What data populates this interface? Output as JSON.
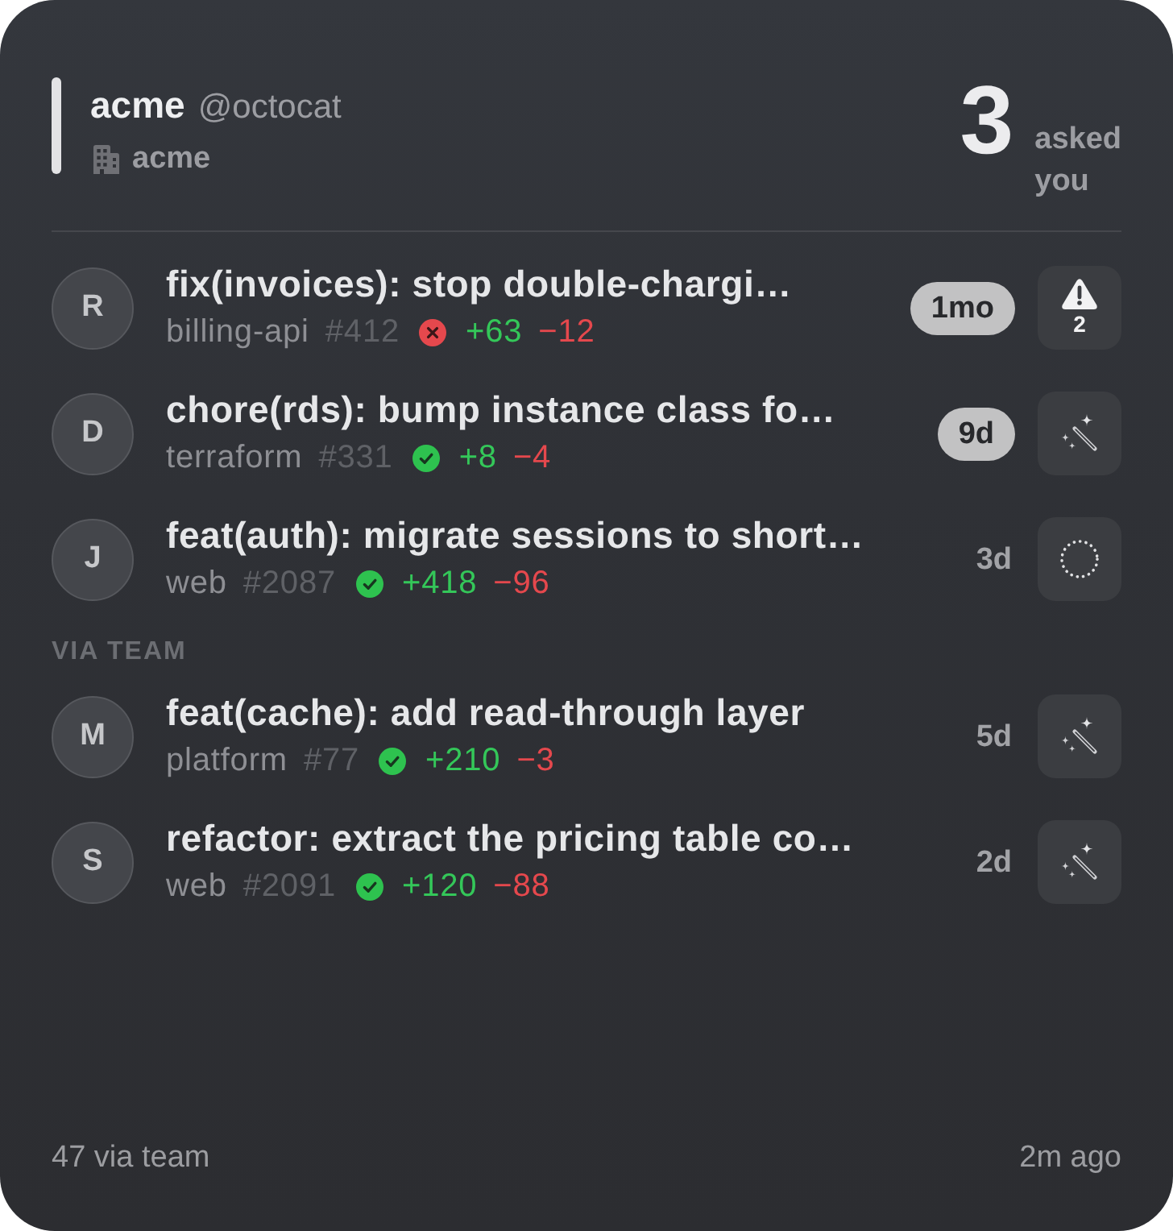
{
  "header": {
    "name": "acme",
    "handle": "@octocat",
    "org": "acme",
    "count": "3",
    "count_label": "asked you"
  },
  "sections": [
    {
      "rows": [
        {
          "initial": "R",
          "title": "fix(invoices): stop double-chargi…",
          "repo": "billing-api",
          "number": "#412",
          "passed": false,
          "additions": "+63",
          "deletions": "−12",
          "age": "1mo",
          "highlighted": true,
          "action": {
            "kind": "alert",
            "count": "2"
          }
        },
        {
          "initial": "D",
          "title": "chore(rds): bump instance class fo…",
          "repo": "terraform",
          "number": "#331",
          "passed": true,
          "additions": "+8",
          "deletions": "−4",
          "age": "9d",
          "highlighted": true,
          "action": {
            "kind": "wand"
          }
        },
        {
          "initial": "J",
          "title": "feat(auth): migrate sessions to short…",
          "repo": "web",
          "number": "#2087",
          "passed": true,
          "additions": "+418",
          "deletions": "−96",
          "age": "3d",
          "highlighted": false,
          "action": {
            "kind": "pending"
          }
        }
      ]
    },
    {
      "label": "VIA TEAM",
      "rows": [
        {
          "initial": "M",
          "title": "feat(cache): add read-through layer",
          "repo": "platform",
          "number": "#77",
          "passed": true,
          "additions": "+210",
          "deletions": "−3",
          "age": "5d",
          "highlighted": false,
          "action": {
            "kind": "wand"
          }
        },
        {
          "initial": "S",
          "title": "refactor: extract the pricing table co…",
          "repo": "web",
          "number": "#2091",
          "passed": true,
          "additions": "+120",
          "deletions": "−88",
          "age": "2d",
          "highlighted": false,
          "action": {
            "kind": "wand"
          }
        }
      ]
    }
  ],
  "footer": {
    "summary": "47 via team",
    "updated": "2m ago"
  }
}
